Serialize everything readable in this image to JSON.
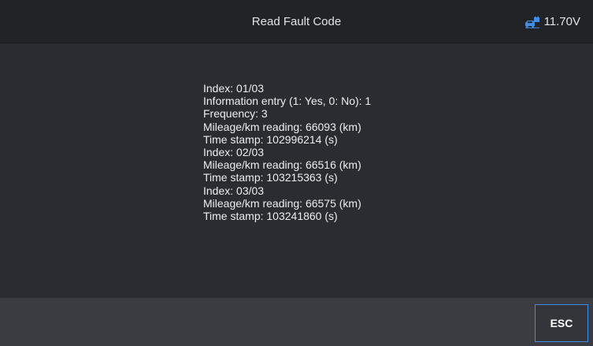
{
  "header": {
    "title": "Read Fault Code",
    "battery_icon": "car-battery-icon",
    "battery_voltage": "11.70V",
    "accent_color": "#3f8ee8"
  },
  "content": {
    "lines": [
      "Index: 01/03",
      "Information entry (1: Yes, 0: No): 1",
      "Frequency: 3",
      "Mileage/km reading: 66093 (km)",
      "Time stamp: 102996214 (s)",
      "Index: 02/03",
      "Mileage/km reading: 66516 (km)",
      "Time stamp: 103215363 (s)",
      "Index: 03/03",
      "Mileage/km reading: 66575 (km)",
      "Time stamp: 103241860 (s)"
    ]
  },
  "footer": {
    "esc_label": "ESC"
  }
}
